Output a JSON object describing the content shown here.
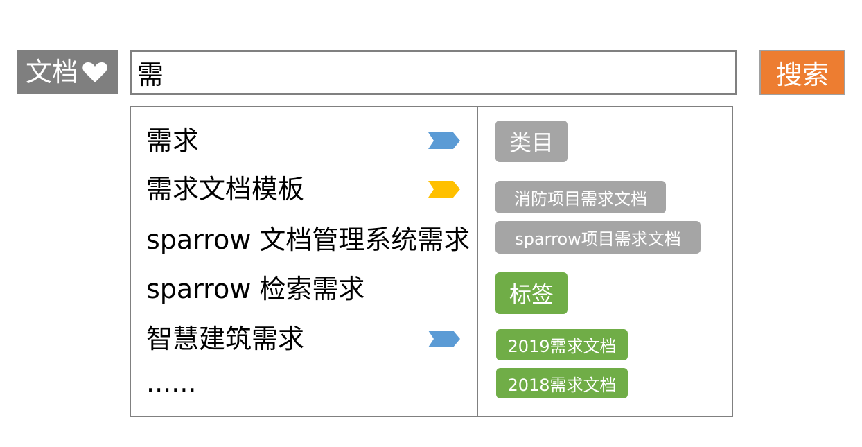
{
  "search": {
    "type_label": "文档",
    "type_icon": "heart-icon",
    "query": "需",
    "button_label": "搜索",
    "button_color": "#ed7d31"
  },
  "suggestions": [
    {
      "label": "需求",
      "arrow": "blue"
    },
    {
      "label": "需求文档模板",
      "arrow": "yellow"
    },
    {
      "label": "sparrow 文档管理系统需求",
      "arrow": null
    },
    {
      "label": "sparrow 检索需求",
      "arrow": null
    },
    {
      "label": "智慧建筑需求",
      "arrow": "blue"
    },
    {
      "label": "......",
      "arrow": null
    }
  ],
  "categories": {
    "title": "类目",
    "items": [
      "消防项目需求文档",
      "sparrow项目需求文档"
    ],
    "color": "#a5a5a5"
  },
  "tags": {
    "title": "标签",
    "items": [
      "2019需求文档",
      "2018需求文档"
    ],
    "color": "#70ad47"
  },
  "colors": {
    "arrow_blue": "#5b9bd5",
    "arrow_yellow": "#ffc000",
    "selector_bg": "#7f7f7f"
  }
}
